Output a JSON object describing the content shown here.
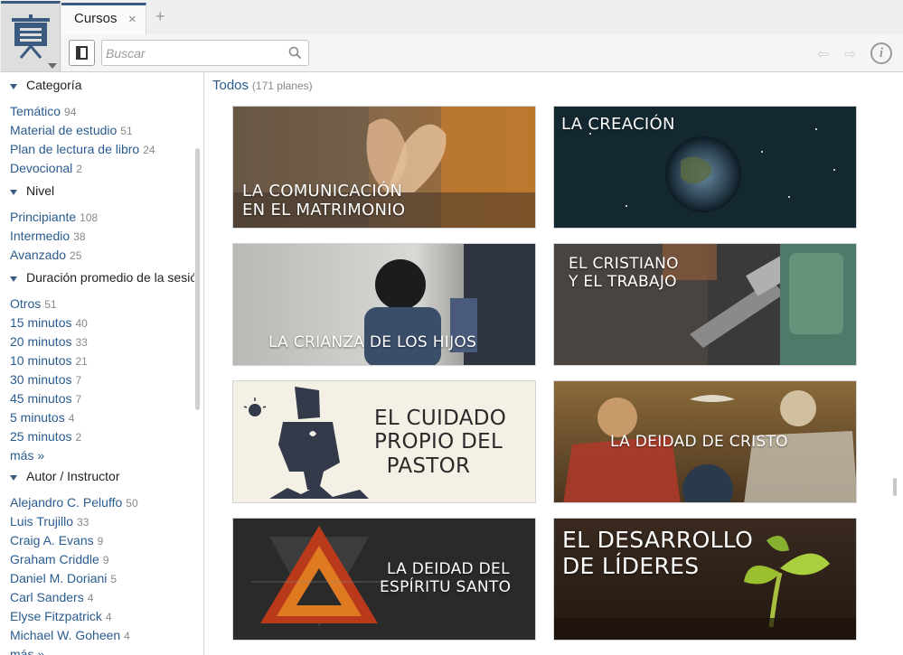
{
  "tab": {
    "label": "Cursos",
    "close": "×",
    "new": "+"
  },
  "toolbar": {
    "search_placeholder": "Buscar",
    "info": "i",
    "back": "⇦",
    "forward": "⇨"
  },
  "breadcrumb": {
    "label": "Todos",
    "count": "(171 planes)"
  },
  "sidebar": {
    "sections": [
      {
        "title": "Categoría",
        "items": [
          {
            "label": "Temático",
            "count": "94"
          },
          {
            "label": "Material de estudio",
            "count": "51"
          },
          {
            "label": "Plan de lectura de libro",
            "count": "24"
          },
          {
            "label": "Devocional",
            "count": "2"
          }
        ]
      },
      {
        "title": "Nivel",
        "items": [
          {
            "label": "Principiante",
            "count": "108"
          },
          {
            "label": "Intermedio",
            "count": "38"
          },
          {
            "label": "Avanzado",
            "count": "25"
          }
        ]
      },
      {
        "title": "Duración promedio de la sesión",
        "items": [
          {
            "label": "Otros",
            "count": "51"
          },
          {
            "label": "15 minutos",
            "count": "40"
          },
          {
            "label": "20 minutos",
            "count": "33"
          },
          {
            "label": "10 minutos",
            "count": "21"
          },
          {
            "label": "30 minutos",
            "count": "7"
          },
          {
            "label": "45 minutos",
            "count": "7"
          },
          {
            "label": "5 minutos",
            "count": "4"
          },
          {
            "label": "25 minutos",
            "count": "2"
          }
        ],
        "more": "más »"
      },
      {
        "title": "Autor / Instructor",
        "items": [
          {
            "label": "Alejandro C. Peluffo",
            "count": "50"
          },
          {
            "label": "Luis Trujillo",
            "count": "33"
          },
          {
            "label": "Craig A. Evans",
            "count": "9"
          },
          {
            "label": "Graham Criddle",
            "count": "9"
          },
          {
            "label": "Daniel M. Doriani",
            "count": "5"
          },
          {
            "label": "Carl Sanders",
            "count": "4"
          },
          {
            "label": "Elyse Fitzpatrick",
            "count": "4"
          },
          {
            "label": "Michael W. Goheen",
            "count": "4"
          }
        ],
        "more": "más »"
      }
    ]
  },
  "courses": [
    {
      "line1": "LA COMUNICACIÓN",
      "line2": "EN EL MATRIMONIO"
    },
    {
      "line1": "LA CREACIÓN",
      "line2": ""
    },
    {
      "line1": "LA CRIANZA DE LOS HIJOS",
      "line2": ""
    },
    {
      "line1": "EL CRISTIANO",
      "line2": "Y EL TRABAJO"
    },
    {
      "line1": "EL CUIDADO",
      "line2": "PROPIO DEL",
      "line3": "PASTOR"
    },
    {
      "line1": "LA DEIDAD DE CRISTO",
      "line2": ""
    },
    {
      "line1": "LA DEIDAD DEL",
      "line2": "ESPÍRITU SANTO"
    },
    {
      "line1": "EL DESARROLLO",
      "line2": "DE LÍDERES"
    }
  ],
  "colors": {
    "accent": "#3b5a80",
    "link": "#2a5b8f"
  }
}
